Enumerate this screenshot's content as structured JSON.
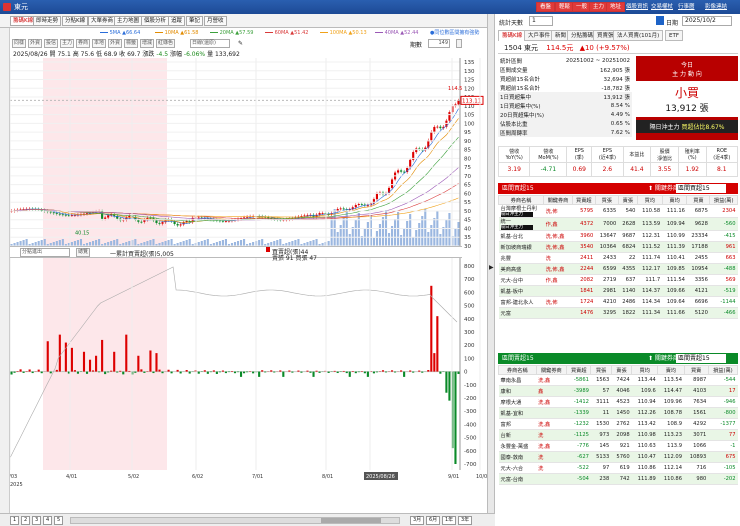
{
  "window": {
    "title": "東元"
  },
  "topbar": {
    "buttons": [
      "看盤",
      "輕鬆",
      "一般",
      "主力",
      "地址"
    ],
    "links": [
      "個股資訊",
      "交易權杖",
      "行事曆",
      "影像連結"
    ]
  },
  "tabs": [
    "籌碼K線",
    "即時走勢",
    "分點K線",
    "大單券商",
    "主力地圖",
    "個股分析",
    "追蹤",
    "筆記",
    "月營收"
  ],
  "active_tab": "籌碼K線",
  "legend": [
    {
      "label": "5MA",
      "value": "▲66.64",
      "color": "#2a6dd9"
    },
    {
      "label": "10MA",
      "value": "▲61.58",
      "color": "#e28b00"
    },
    {
      "label": "20MA",
      "value": "▲57.59",
      "color": "#3ca03c"
    },
    {
      "label": "60MA",
      "value": "▲51.42",
      "color": "#d93a3a"
    },
    {
      "label": "100MA",
      "value": "▲50.13",
      "color": "#f0a21a"
    },
    {
      "label": "40MA",
      "value": "▲52.44",
      "color": "#9b59b6"
    }
  ],
  "legend_note": "●同位數區間擁有強勢",
  "toolbar": {
    "buttons": [
      "同樣",
      "外資",
      "投信",
      "主力",
      "券商",
      "本地",
      "外資",
      "標籤",
      "增減",
      "紅綠色"
    ],
    "period_select": "日線(還原)",
    "periods_label": "期數",
    "periods_value": "149"
  },
  "info": {
    "date": "2025/08/26",
    "open_label": "開",
    "open": "75.1",
    "high_label": "高",
    "high": "75.6",
    "low_label": "低",
    "low": "68.9",
    "close_label": "收",
    "close": "69.7",
    "change_label": "漲跌",
    "change": "-4.5",
    "pct_label": "漲幅",
    "pct": "-6.06%",
    "vol_label": "量",
    "vol": "133,692"
  },
  "price_axis": [
    "135",
    "130",
    "125",
    "120",
    "115",
    "110",
    "105",
    "100",
    "95",
    "90",
    "85",
    "80",
    "75",
    "70",
    "65",
    "60",
    "55",
    "50",
    "45",
    "40",
    "35",
    "30"
  ],
  "price_marker": "113.11",
  "price_hi": "114.5",
  "price_low_label": "40.15",
  "chip_header": {
    "select": "分點進出",
    "btn": "總覽",
    "accum": "一累計買賣超(張)5,005",
    "buy_label": "買賣超(張)44",
    "sell_label": "賣張 91 買張 47"
  },
  "chip_axis": [
    "800",
    "700",
    "600",
    "500",
    "400",
    "300",
    "200",
    "100",
    "0",
    "-100",
    "-200",
    "-300",
    "-400",
    "-500",
    "-600",
    "-700"
  ],
  "x_dates": [
    "3/03",
    "4/01",
    "5/02",
    "6/02",
    "7/01",
    "8/01",
    "2025/08/26",
    "9/01",
    "10/01"
  ],
  "x_year": "2025",
  "bottom_buttons": [
    "1",
    "2",
    "3",
    "4",
    "5"
  ],
  "range_buttons": [
    "3月",
    "6月",
    "1年",
    "3年"
  ],
  "right": {
    "stat_days_label": "統計天數",
    "stat_days": "1",
    "date_label": "日期",
    "date_value": "2025/10/2",
    "tabs": [
      "籌碼K線",
      "大戶事件",
      "新聞",
      "分點籌碼",
      "買賣張",
      "法人買賣(101月)",
      "ETF"
    ],
    "stock": "1504 東元",
    "price": "114.5元",
    "chg": "▲10 (+9.57%)",
    "stats": [
      {
        "k": "統計區間",
        "v": "20251002 ~ 20251002"
      },
      {
        "k": "區間成交量",
        "v": "162,905 張"
      },
      {
        "k": "買超前15名合計",
        "v": "32,694 張"
      },
      {
        "k": "賣超前15名合計",
        "v": "-18,782 張"
      },
      {
        "k": "1日買超集中",
        "v": "13,912 張"
      },
      {
        "k": "1日買超集中(%)",
        "v": "8.54 %"
      },
      {
        "k": "20日買超集中(%)",
        "v": "4.49 %"
      },
      {
        "k": "佔股本比重",
        "v": "0.65 %"
      },
      {
        "k": "區間周轉率",
        "v": "7.62 %"
      }
    ],
    "today_box": {
      "title1": "今日",
      "title2": "主 力 動 向",
      "big": "小買",
      "amt": "13,912 張",
      "foot1": "隔日沖主力",
      "foot2": "買超佔比8.67%"
    },
    "kpi_heads": [
      "營收\nYoY(%)",
      "營收\nMoM(%)",
      "EPS\n(季)",
      "EPS\n(近4季)",
      "本益比",
      "股價\n淨值比",
      "殖利率\n(%)",
      "ROE\n(近4季)"
    ],
    "kpi_vals": [
      "3.19",
      "-4.71",
      "0.69",
      "2.6",
      "41.4",
      "3.55",
      "1.92",
      "8.1"
    ],
    "buy_title": "區間買超15",
    "buy_select": "區間買超15",
    "sell_title": "區間賣超15",
    "sell_select": "區間賣超15",
    "col_heads": [
      "券商名稱",
      "關鍵券商",
      "買賣超",
      "買張",
      "賣張",
      "買均",
      "賣均",
      "買賣",
      "損益(萬)"
    ],
    "buy_rows": [
      [
        "台灣摩根士丹利",
        "洗,佈",
        "5795",
        "6335",
        "540",
        "110.58",
        "111.16",
        "6875",
        "2304"
      ],
      [
        "統一",
        "作,鑫",
        "4372",
        "7000",
        "2628",
        "113.59",
        "109.94",
        "9628",
        "-560"
      ],
      [
        "凱基-台北",
        "洗,佈,鑫",
        "3960",
        "13647",
        "9687",
        "112.31",
        "110.99",
        "23334",
        "-415"
      ],
      [
        "新加坡商瑞銀",
        "洗,佈,鑫",
        "3540",
        "10364",
        "6824",
        "111.52",
        "111.39",
        "17188",
        "961"
      ],
      [
        "兆豐",
        "洗",
        "2411",
        "2433",
        "22",
        "111.74",
        "110.41",
        "2455",
        "663"
      ],
      [
        "美商高盛",
        "洗,佈,鑫",
        "2244",
        "6599",
        "4355",
        "112.17",
        "109.85",
        "10954",
        "-488"
      ],
      [
        "元大-台中",
        "作,鑫",
        "2082",
        "2719",
        "637",
        "111.7",
        "111.54",
        "3356",
        "569"
      ],
      [
        "凱基-板中",
        "",
        "1841",
        "2981",
        "1140",
        "114.37",
        "109.66",
        "4121",
        "-519"
      ],
      [
        "富邦-建北永人",
        "洗,佈",
        "1724",
        "4210",
        "2486",
        "114.34",
        "109.64",
        "6696",
        "-1144"
      ],
      [
        "元富",
        "",
        "1476",
        "3295",
        "1822",
        "111.34",
        "111.66",
        "5120",
        "-466"
      ]
    ],
    "sell_rows": [
      [
        "華南永昌",
        "洗,鑫",
        "-5861",
        "1563",
        "7424",
        "113.44",
        "113.54",
        "8987",
        "-544"
      ],
      [
        "康和",
        "鑫",
        "-3989",
        "57",
        "4046",
        "109.6",
        "114.47",
        "4103",
        "17"
      ],
      [
        "摩根大通",
        "洗,鑫",
        "-1412",
        "3111",
        "4523",
        "110.94",
        "109.96",
        "7634",
        "-946"
      ],
      [
        "凱基-宜和",
        "",
        "-1339",
        "11",
        "1450",
        "112.26",
        "108.78",
        "1561",
        "-800"
      ],
      [
        "富邦",
        "洗,鑫",
        "-1232",
        "1530",
        "2762",
        "113.42",
        "108.9",
        "4292",
        "-1377"
      ],
      [
        "台新",
        "洗",
        "-1125",
        "973",
        "2098",
        "110.98",
        "113.23",
        "3071",
        "77"
      ],
      [
        "永豐金-萬盛",
        "洗,鑫",
        "-776",
        "145",
        "921",
        "110.63",
        "113.9",
        "1066",
        "-1"
      ],
      [
        "國泰-敦南",
        "洗",
        "-627",
        "5133",
        "5760",
        "110.47",
        "112.09",
        "10893",
        "675"
      ],
      [
        "元大-六合",
        "洗",
        "-522",
        "97",
        "619",
        "110.86",
        "112.14",
        "716",
        "-105"
      ],
      [
        "元富-台南",
        "",
        "-504",
        "238",
        "742",
        "111.89",
        "110.86",
        "980",
        "-202"
      ]
    ],
    "tag1": "隔日沖主力"
  },
  "colors": {
    "red": "#d40000",
    "green": "#0a8a28",
    "blue": "#1d4a95"
  }
}
